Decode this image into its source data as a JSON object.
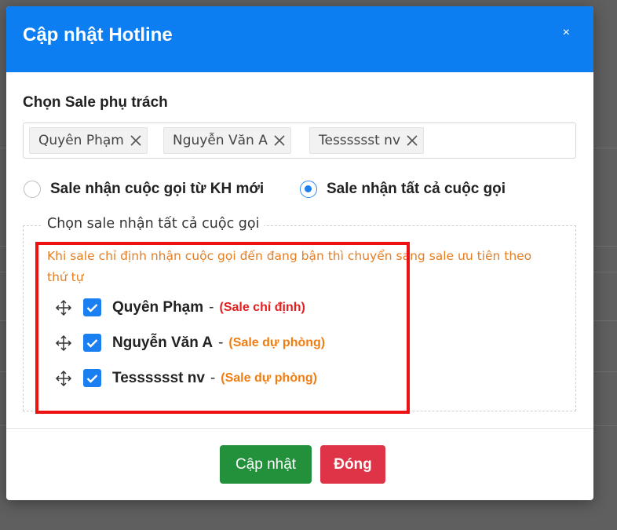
{
  "modal": {
    "title": "Cập nhật Hotline",
    "close_icon": "×"
  },
  "sale_select": {
    "label": "Chọn Sale phụ trách",
    "tags": [
      "Quyên Phạm",
      "Nguyễn Văn A",
      "Tesssssst nv"
    ]
  },
  "radios": [
    {
      "label": "Sale nhận cuộc gọi từ KH mới",
      "checked": false
    },
    {
      "label": "Sale nhận tất cả cuộc gọi",
      "checked": true
    }
  ],
  "priority": {
    "legend": "Chọn sale nhận tất cả cuộc gọi",
    "hint": "Khi sale chỉ định nhận cuộc gọi đến đang bận thì chuyển sang sale ưu tiên theo thứ tự",
    "separator": "-",
    "items": [
      {
        "name": "Quyên Phạm",
        "role": "(Sale chỉ định)",
        "checked": true
      },
      {
        "name": "Nguyễn Văn A",
        "role": "(Sale dự phòng)",
        "checked": true
      },
      {
        "name": "Tesssssst nv",
        "role": "(Sale dự phòng)",
        "checked": true
      }
    ]
  },
  "footer": {
    "update_label": "Cập nhật",
    "close_label": "Đóng"
  },
  "colors": {
    "header": "#0d7ef2",
    "update_button": "#23903c",
    "close_button": "#df3347",
    "hint_text": "#e67e22",
    "primary_role": "#e02020",
    "backup_role": "#f07d12",
    "highlight_box": "#ee1111"
  }
}
